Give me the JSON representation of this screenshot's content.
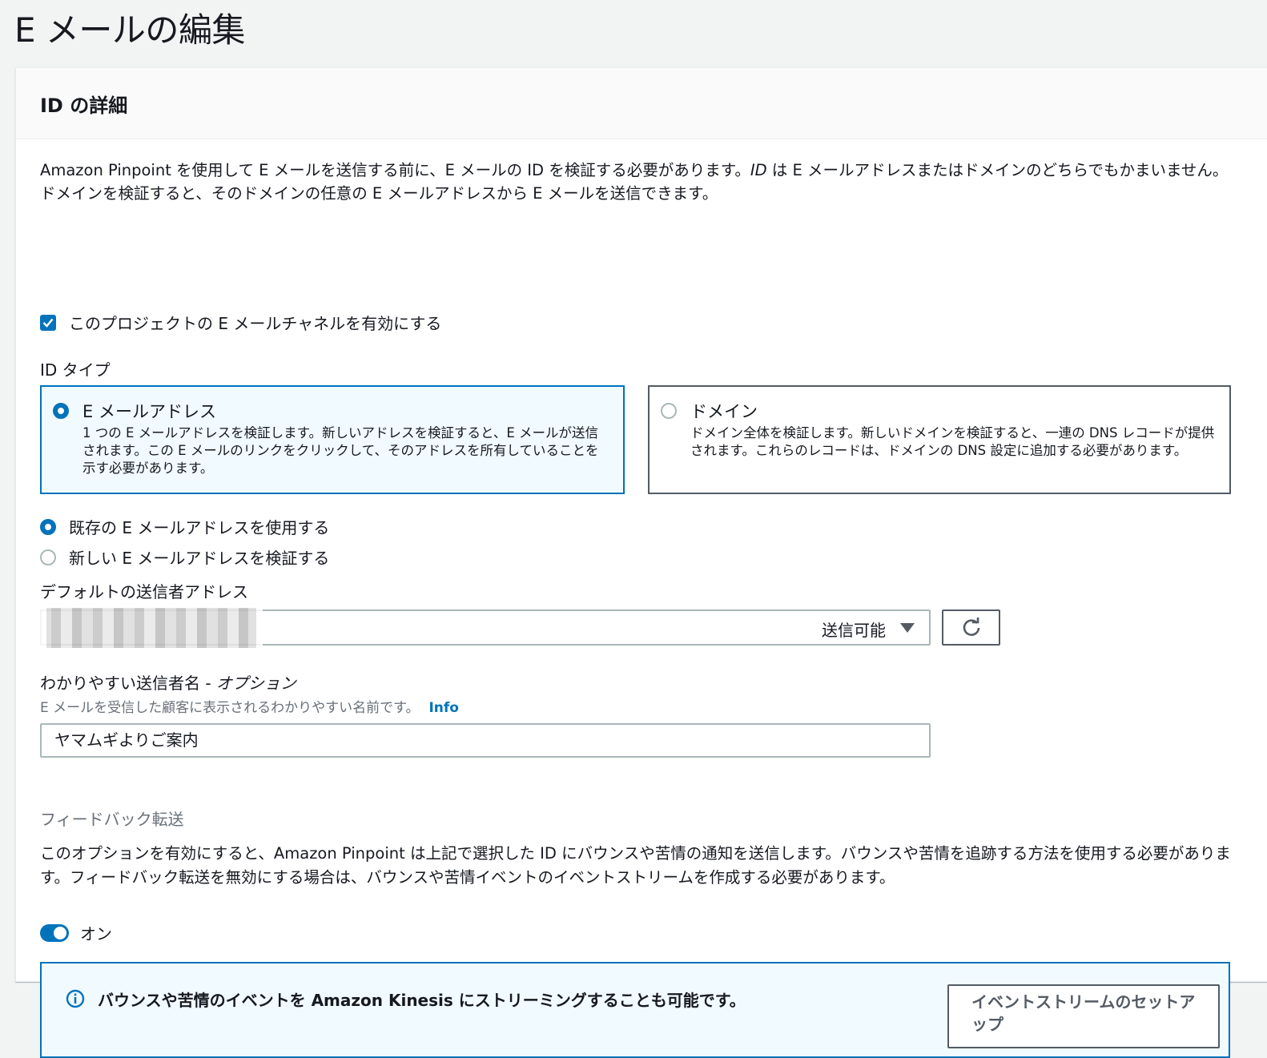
{
  "page": {
    "title": "E メールの編集"
  },
  "panel": {
    "title": "ID の詳細"
  },
  "intro": {
    "part1": "Amazon Pinpoint を使用して E メールを送信する前に、E メールの ID を検証する必要があります。",
    "italic": "ID",
    "part2": " は E メールアドレスまたはドメインのどちらでもかまいません。ドメインを検証すると、そのドメインの任意の E メールアドレスから E メールを送信できます。"
  },
  "enable_channel": {
    "label": "このプロジェクトの E メールチャネルを有効にする",
    "checked": true
  },
  "identity_type": {
    "label": "ID タイプ",
    "options": [
      {
        "title": "E メールアドレス",
        "description": "1 つの E メールアドレスを検証します。新しいアドレスを検証すると、E メールが送信されます。この E メールのリンクをクリックして、そのアドレスを所有していることを示す必要があります。",
        "selected": true
      },
      {
        "title": "ドメイン",
        "description": "ドメイン全体を検証します。新しいドメインを検証すると、一連の DNS レコードが提供されます。これらのレコードは、ドメインの DNS 設定に追加する必要があります。",
        "selected": false
      }
    ]
  },
  "address_mode": {
    "options": [
      {
        "label": "既存の E メールアドレスを使用する",
        "selected": true
      },
      {
        "label": "新しい E メールアドレスを検証する",
        "selected": false
      }
    ]
  },
  "sender_address": {
    "label": "デフォルトの送信者アドレス",
    "status": "送信可能"
  },
  "friendly_name": {
    "label": "わかりやすい送信者名 - ",
    "label_optional": "オプション",
    "description": "E メールを受信した顧客に表示されるわかりやすい名前です。",
    "info_link": "Info",
    "value": "ヤマムギよりご案内"
  },
  "feedback": {
    "heading": "フィードバック転送",
    "description": "このオプションを有効にすると、Amazon Pinpoint は上記で選択した ID にバウンスや苦情の通知を送信します。バウンスや苦情を追跡する方法を使用する必要があります。フィードバック転送を無効にする場合は、バウンスや苦情イベントのイベントストリームを作成する必要があります。",
    "toggle_label": "オン",
    "toggle_on": true
  },
  "alert": {
    "text": "バウンスや苦情のイベントを Amazon Kinesis にストリーミングすることも可能です。",
    "button": "イベントストリームのセットアップ"
  },
  "colors": {
    "accent": "#0073bb",
    "border": "#aab7b8",
    "text": "#16191f",
    "muted": "#687078"
  }
}
